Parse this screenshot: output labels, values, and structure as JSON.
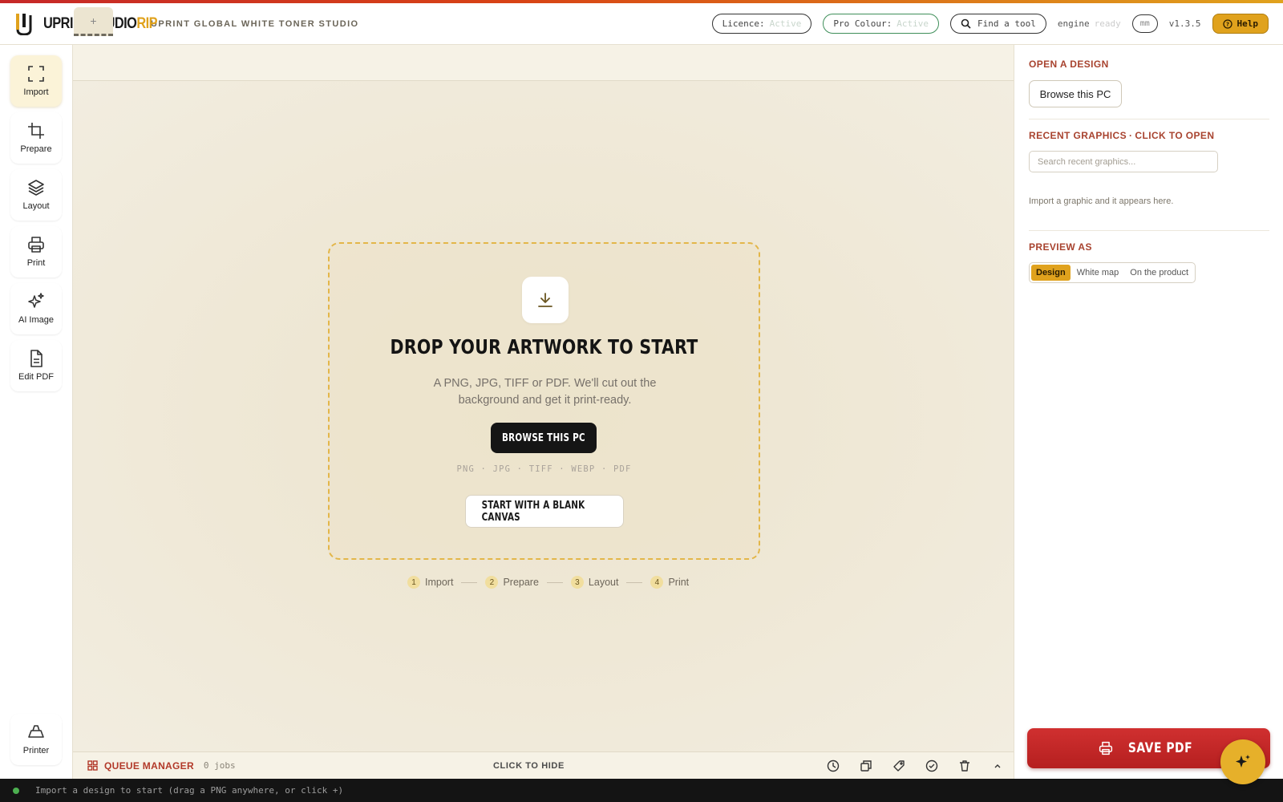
{
  "app": {
    "brand_main": "UPRINTSTUDIO",
    "brand_accent": "RIP",
    "subtitle": "UPRINT GLOBAL WHITE TONER STUDIO"
  },
  "header": {
    "licence_label": "Licence:",
    "licence_value": "Active",
    "pro_colour_label": "Pro Colour:",
    "pro_colour_value": "Active",
    "search_label": "Find a tool",
    "engine_label": "engine",
    "engine_value": "ready",
    "unit": "mm",
    "version": "v1.3.5",
    "help_label": "Help"
  },
  "rail": {
    "items": [
      {
        "label": "Import",
        "icon": "import-frame-icon"
      },
      {
        "label": "Prepare",
        "icon": "crop-icon"
      },
      {
        "label": "Layout",
        "icon": "layers-icon"
      },
      {
        "label": "Print",
        "icon": "printer-icon"
      },
      {
        "label": "AI Image",
        "icon": "sparkle-icon"
      },
      {
        "label": "Edit PDF",
        "icon": "document-icon"
      }
    ],
    "bottom_label": "Printer"
  },
  "tabs": {
    "add_label": "+"
  },
  "dropzone": {
    "title": "DROP YOUR ARTWORK TO START",
    "description": "A PNG, JPG, TIFF or PDF. We'll cut out the background and get it print-ready.",
    "browse_label": "BROWSE THIS PC",
    "formats": "PNG · JPG · TIFF · WEBP · PDF",
    "blank_label": "START WITH A BLANK CANVAS"
  },
  "steps": [
    {
      "num": "1",
      "label": "Import"
    },
    {
      "num": "2",
      "label": "Prepare"
    },
    {
      "num": "3",
      "label": "Layout"
    },
    {
      "num": "4",
      "label": "Print"
    }
  ],
  "queue": {
    "title": "QUEUE MANAGER",
    "count": "0 jobs",
    "hide_label": "CLICK TO HIDE"
  },
  "status": {
    "text": "Import a design to start (drag a PNG anywhere, or click +)"
  },
  "panel": {
    "open_title": "OPEN A DESIGN",
    "browse_label": "Browse this PC",
    "recent_title": "RECENT GRAPHICS",
    "recent_sep": "·",
    "recent_sub": "CLICK TO OPEN",
    "search_placeholder": "Search recent graphics...",
    "hint": "Import a graphic and it appears here.",
    "preview_title": "PREVIEW AS",
    "preview_options": [
      "Design",
      "White map",
      "On the product"
    ],
    "preview_selected": "Design"
  },
  "save_pdf_label": "SAVE PDF",
  "colors": {
    "accent": "#e0a21d",
    "danger": "#c62828",
    "section_title": "#a8432f"
  }
}
